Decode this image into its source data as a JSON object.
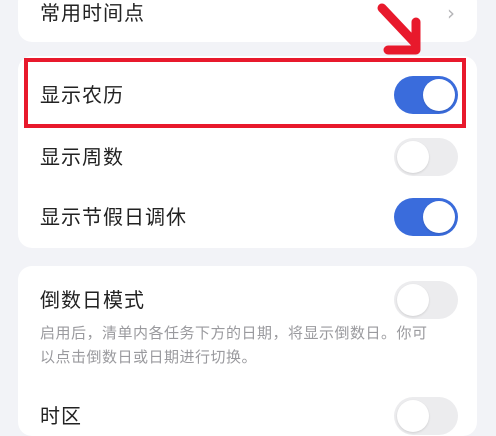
{
  "settings": {
    "common_times": {
      "label": "常用时间点",
      "chevron": "›"
    },
    "lunar": {
      "label": "显示农历",
      "enabled": true
    },
    "week_number": {
      "label": "显示周数",
      "enabled": false
    },
    "holiday": {
      "label": "显示节假日调休",
      "enabled": true
    },
    "countdown": {
      "label": "倒数日模式",
      "enabled": false,
      "description": "启用后，清单内各任务下方的日期，将显示倒数日。你可以点击倒数日或日期进行切换。"
    },
    "timezone": {
      "label": "时区",
      "enabled": false
    }
  },
  "annotation": {
    "highlight_color": "#e8192c",
    "arrow_icon": "red-arrow-icon"
  },
  "colors": {
    "toggle_on": "#3a6cdc",
    "toggle_off": "#ececee",
    "background": "#f2f3f7"
  }
}
